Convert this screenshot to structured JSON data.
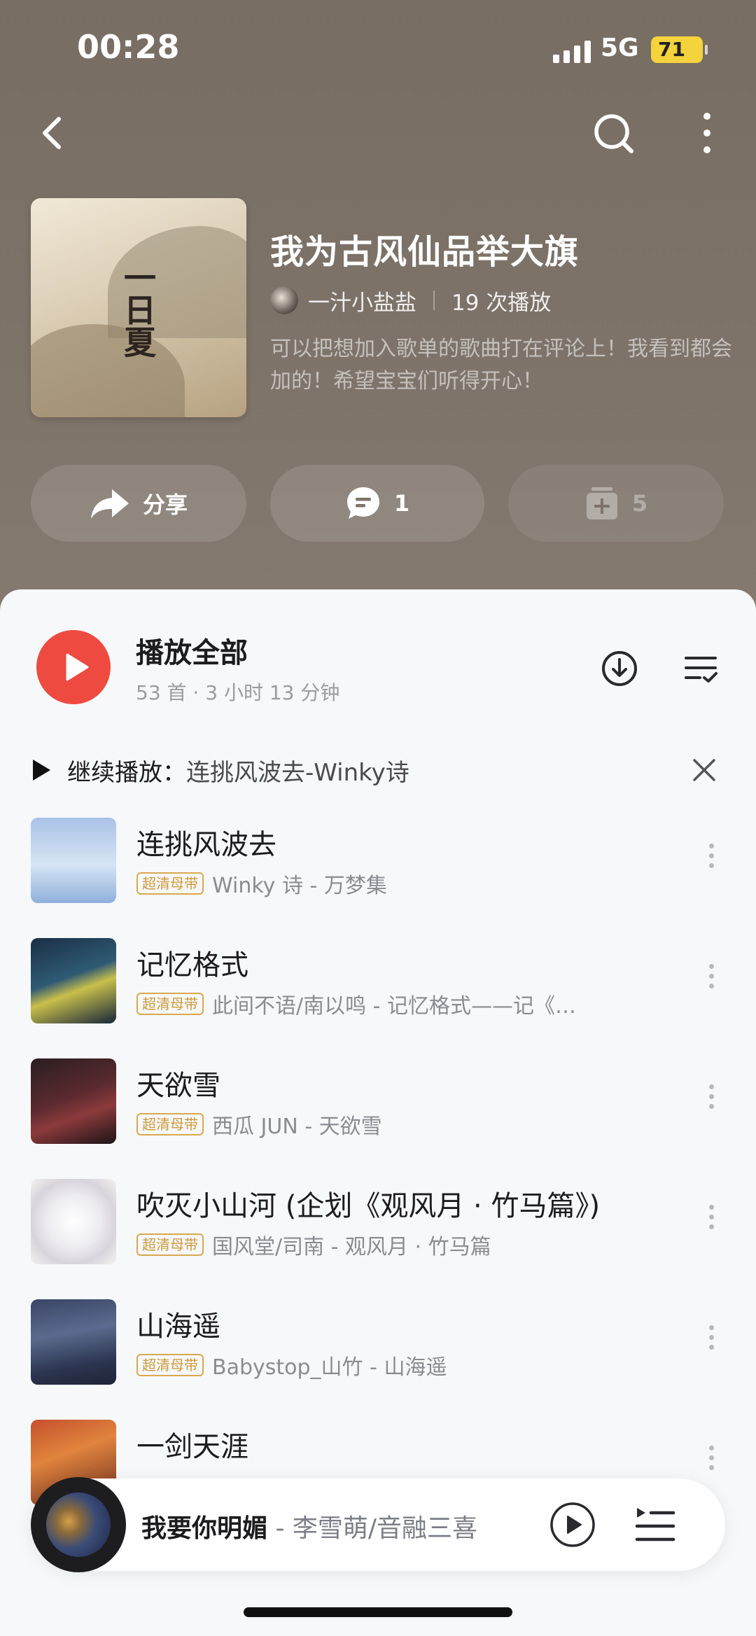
{
  "status_bar": {
    "time": "00:28",
    "network": "5G",
    "battery": "71"
  },
  "playlist": {
    "title": "我为古风仙品举大旗",
    "creator": "一汁小盐盐",
    "play_count": "19 次播放",
    "description": "可以把想加入歌单的歌曲打在评论上！我看到都会加的！希望宝宝们听得开心！",
    "cover_text": "一日夏"
  },
  "actions": {
    "share_label": "分享",
    "comment_count": "1",
    "collect_count": "5"
  },
  "play_all": {
    "label": "播放全部",
    "meta": "53 首 · 3 小时 13 分钟"
  },
  "resume": {
    "prefix": "继续播放：",
    "track": "连挑风波去-Winky诗"
  },
  "songs": [
    {
      "title": "连挑风波去",
      "title_suffix": "",
      "badge": "超清母带",
      "artist": "Winky 诗 - 万梦集"
    },
    {
      "title": "记忆格式",
      "title_suffix": "",
      "badge": "超清母带",
      "artist": "此间不语/南以鸣 - 记忆格式——记《…"
    },
    {
      "title": "天欲雪",
      "title_suffix": "",
      "badge": "超清母带",
      "artist": "西瓜 JUN - 天欲雪"
    },
    {
      "title": "吹灭小山河",
      "title_suffix": " (企划《观风月 · 竹马篇》)",
      "badge": "超清母带",
      "artist": "国风堂/司南 - 观风月 · 竹马篇"
    },
    {
      "title": "山海遥",
      "title_suffix": "",
      "badge": "超清母带",
      "artist": "Babystop_山竹 - 山海遥"
    },
    {
      "title": "一剑天涯",
      "title_suffix": "",
      "badge": "",
      "artist": ""
    }
  ],
  "now_playing": {
    "title": "我要你明媚",
    "artist": " - 李雪萌/音融三喜"
  },
  "colors": {
    "accent": "#ee4a40",
    "badge": "#cf9a39",
    "header_bg": "#7a7066"
  }
}
